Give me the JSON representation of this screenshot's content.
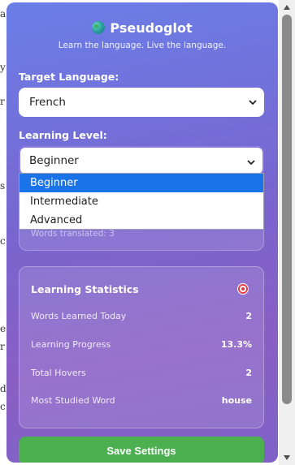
{
  "background_page": {
    "fragments": [
      "a",
      "y",
      "r",
      "s",
      "c",
      "e",
      "r",
      "d",
      "c"
    ]
  },
  "header": {
    "app_name": "Pseudoglot",
    "logo_icon": "globe-icon",
    "tagline": "Learn the language. Live the language."
  },
  "target_language": {
    "label": "Target Language:",
    "selected": "French"
  },
  "learning_level": {
    "label": "Learning Level:",
    "selected": "Beginner",
    "options": [
      "Beginner",
      "Intermediate",
      "Advanced"
    ],
    "highlighted_index": 0
  },
  "session_card": {
    "words_translated": "Words translated: 3"
  },
  "stats": {
    "title": "Learning Statistics",
    "icon": "target-icon",
    "rows": [
      {
        "label": "Words Learned Today",
        "value": "2"
      },
      {
        "label": "Learning Progress",
        "value": "13.3%"
      },
      {
        "label": "Total Hovers",
        "value": "2"
      },
      {
        "label": "Most Studied Word",
        "value": "house"
      }
    ]
  },
  "actions": {
    "save_label": "Save Settings"
  },
  "colors": {
    "accent_green": "#4caf50",
    "dropdown_highlight": "#1a73e8",
    "gradient_start": "#6b7ee8",
    "gradient_end": "#8a5fc4"
  }
}
